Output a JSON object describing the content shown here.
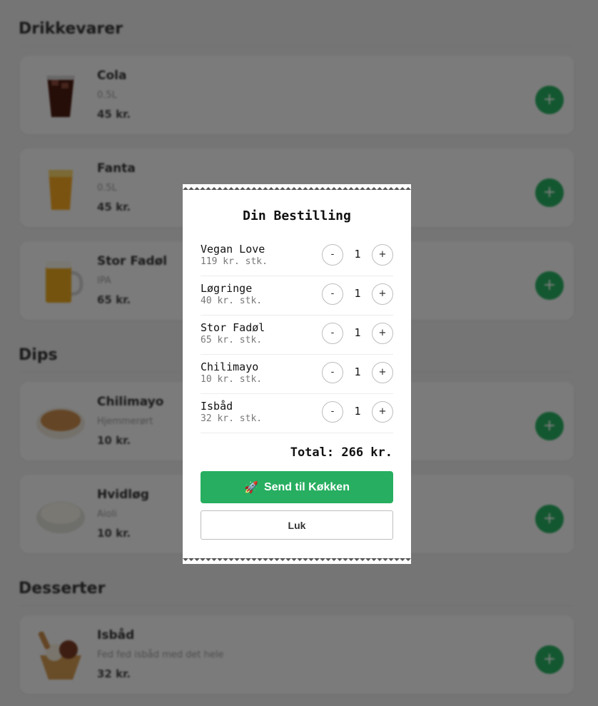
{
  "menu": {
    "sections": [
      {
        "title": "Drikkevarer",
        "items": [
          {
            "name": "Cola",
            "desc": "0.5L",
            "price": "45 kr.",
            "img": "cola-drink"
          },
          {
            "name": "Fanta",
            "desc": "0.5L",
            "price": "45 kr.",
            "img": "fanta-drink"
          },
          {
            "name": "Stor Fadøl",
            "desc": "IPA",
            "price": "65 kr.",
            "img": "beer-mug"
          }
        ]
      },
      {
        "title": "Dips",
        "items": [
          {
            "name": "Chilimayo",
            "desc": "Hjemmerørt",
            "price": "10 kr.",
            "img": "chilimayo-bowl"
          },
          {
            "name": "Hvidløg",
            "desc": "Aioli",
            "price": "10 kr.",
            "img": "aioli-bowl"
          }
        ]
      },
      {
        "title": "Desserter",
        "items": [
          {
            "name": "Isbåd",
            "desc": "Fed fed isbåd med det hele",
            "price": "32 kr.",
            "img": "ice-cream-cone"
          }
        ]
      }
    ],
    "add_label": "+",
    "accent": "#27ae60"
  },
  "order": {
    "title": "Din Bestilling",
    "items": [
      {
        "name": "Vegan Love",
        "price": "119 kr. stk.",
        "qty": "1"
      },
      {
        "name": "Løgringe",
        "price": "40 kr. stk.",
        "qty": "1"
      },
      {
        "name": "Stor Fadøl",
        "price": "65 kr. stk.",
        "qty": "1"
      },
      {
        "name": "Chilimayo",
        "price": "10 kr. stk.",
        "qty": "1"
      },
      {
        "name": "Isbåd",
        "price": "32 kr. stk.",
        "qty": "1"
      }
    ],
    "minus_label": "-",
    "plus_label": "+",
    "total": "Total: 266 kr.",
    "send_icon": "rocket-icon",
    "send_glyph": "🚀",
    "send_label": "Send til Køkken",
    "close_label": "Luk"
  }
}
